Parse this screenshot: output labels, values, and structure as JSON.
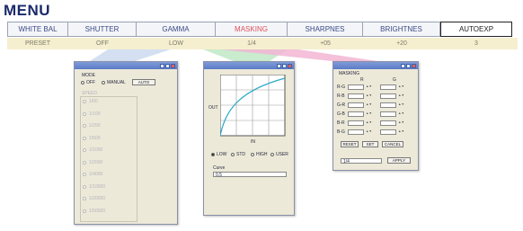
{
  "menu": {
    "title": "MENU"
  },
  "tabs": [
    {
      "label": "WHITE BAL",
      "value": "PRESET"
    },
    {
      "label": "SHUTTER",
      "value": "OFF"
    },
    {
      "label": "GAMMA",
      "value": "LOW"
    },
    {
      "label": "MASKING",
      "value": "1/4"
    },
    {
      "label": "SHARPNES",
      "value": "+05"
    },
    {
      "label": "BRIGHTNES",
      "value": "+20"
    },
    {
      "label": "AUTOEXP",
      "value": "3"
    }
  ],
  "active_tab_color": "#e0505a",
  "shutter_dialog": {
    "group_label": "MODE",
    "options": [
      "OFF",
      "MANUAL",
      "AUTO"
    ],
    "selected": "AUTO",
    "speed_label": "SPEED",
    "speeds": [
      "1/60",
      "1/100",
      "1/250",
      "1/500",
      "1/1000",
      "1/2000",
      "1/4000",
      "1/10000",
      "1/20000",
      "1/50000"
    ]
  },
  "gamma_dialog": {
    "axis_y": "OUT",
    "axis_x": "IN",
    "presets": [
      "LOW",
      "STD",
      "HIGH",
      "USER"
    ],
    "curve_label": "Curve",
    "curve_value": "0.5"
  },
  "masking_dialog": {
    "header": "MASKING",
    "col_left": "R",
    "col_right": "G",
    "rows": [
      "R-G",
      "R-B",
      "G-R",
      "G-B",
      "B-R",
      "B-G"
    ],
    "buttons": [
      "RESET",
      "SET",
      "CANCEL"
    ],
    "footer_value": "1/4",
    "footer_btn": "APPLY"
  },
  "wedge_colors": {
    "shutter": "#c9d8ef",
    "gamma": "#bfe8c6",
    "masking": "#f2b5d4"
  }
}
